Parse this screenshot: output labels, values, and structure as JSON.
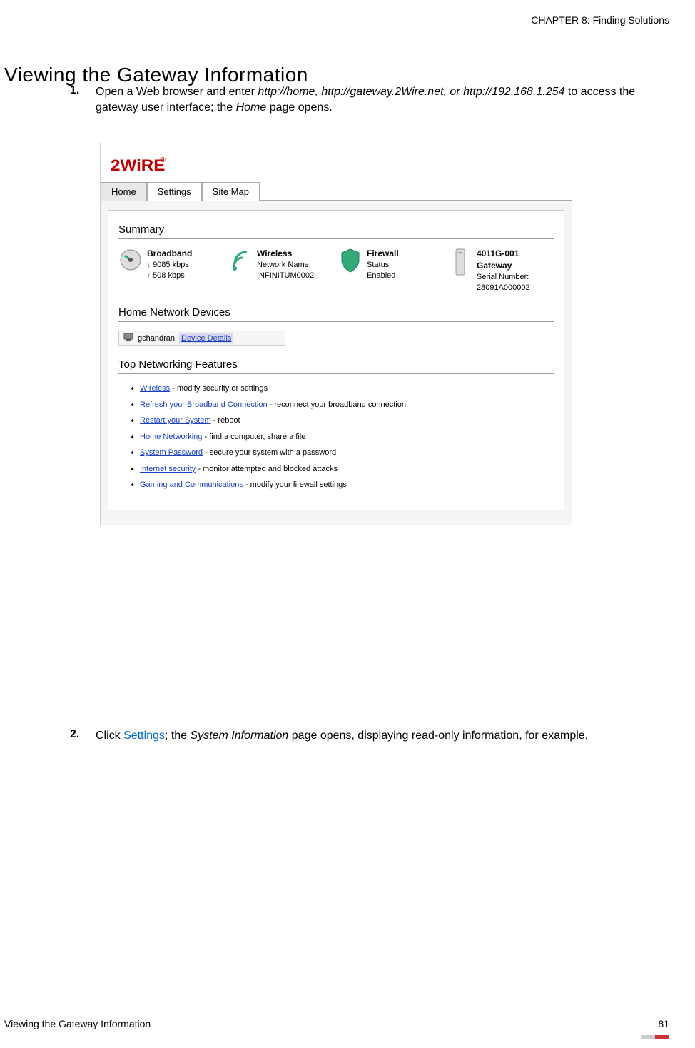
{
  "chapter_header": "CHAPTER 8: Finding Solutions",
  "main_heading": "Viewing the Gateway Information",
  "step1": {
    "num": "1.",
    "pre": "Open a Web browser and enter ",
    "urls": "http://home, http://gateway.2Wire.net, or http://192.168.1.254",
    "mid": " to access the gateway user interface; the ",
    "page": "Home",
    "post": " page opens."
  },
  "screenshot": {
    "logo": "2WiRE",
    "tabs": {
      "t1": "Home",
      "t2": "Settings",
      "t3": "Site Map"
    },
    "summary_title": "Summary",
    "broadband": {
      "label": "Broadband",
      "down": "9085 kbps",
      "up": "508 kbps"
    },
    "wireless": {
      "label": "Wireless",
      "field": "Network Name:",
      "value": "INFINITUM0002"
    },
    "firewall": {
      "label": "Firewall",
      "field": "Status:",
      "value": "Enabled"
    },
    "gateway": {
      "label": "4011G-001 Gateway",
      "field": "Serial Number:",
      "value": "28091A000002"
    },
    "devices_title": "Home Network Devices",
    "device": {
      "name": "gchandran",
      "link": "Device Details"
    },
    "features_title": "Top Networking Features",
    "features": [
      {
        "link": "Wireless",
        "suffix": " - modify security or settings"
      },
      {
        "link": "Refresh your Broadband Connection",
        "suffix": " - reconnect your broadband connection"
      },
      {
        "link": "Restart your System",
        "suffix": " - reboot"
      },
      {
        "link": "Home Networking",
        "suffix": " - find a computer, share a file"
      },
      {
        "link": "System Password",
        "suffix": " - secure your system with a password"
      },
      {
        "link": "Internet security",
        "suffix": " - monitor attempted and blocked attacks"
      },
      {
        "link": "Gaming and Communications",
        "suffix": " - modify your firewall settings"
      }
    ]
  },
  "step2": {
    "num": "2.",
    "pre": "Click ",
    "link": "Settings",
    "mid": "; the ",
    "page": "System Information",
    "post": " page opens, displaying read-only information, for example,"
  },
  "footer": {
    "left": "Viewing the Gateway Information",
    "right": "81"
  }
}
